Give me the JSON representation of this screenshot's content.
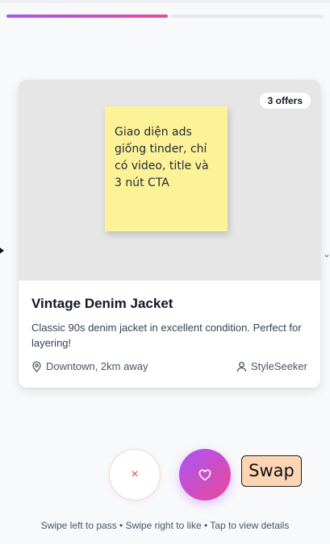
{
  "progress": {
    "current": 1,
    "total": 2
  },
  "card": {
    "offers_badge": "3 offers",
    "sticky_note": "Giao diện ads giống tinder, chỉ có video, title và 3 nút CTA",
    "title": "Vintage Denim Jacket",
    "description": "Classic 90s denim jacket in excellent condition. Perfect for layering!",
    "location": "Downtown, 2km away",
    "seller": "StyleSeeker",
    "location_icon": "map-pin-icon",
    "seller_icon": "user-icon"
  },
  "actions": {
    "pass_label": "×",
    "pass_icon": "close-icon",
    "like_icon": "heart-icon",
    "swap_label": "Swap"
  },
  "hint": "Swipe left to pass • Swipe right to like • Tap to view details",
  "colors": {
    "accent_start": "#a855f7",
    "accent_end": "#ec4899",
    "pass_red": "#ef4444",
    "sticky_yellow": "#fdf298",
    "swap_peach": "#fbd5b4"
  }
}
